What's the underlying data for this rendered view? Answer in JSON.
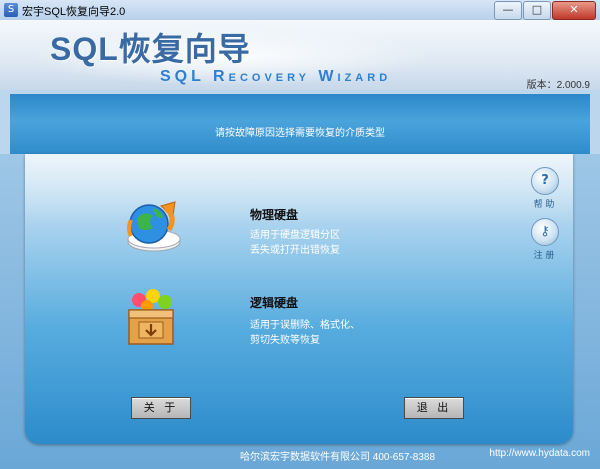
{
  "window": {
    "title": "宏宇SQL恢复向导2.0",
    "app_icon": "S",
    "controls": {
      "minimize": "—",
      "maximize": "□",
      "close": "✕"
    }
  },
  "header": {
    "main_title": "SQL恢复向导",
    "sub_title": "SQL Recovery Wizard",
    "version": "版本：2.000.9"
  },
  "instruction": "请按故障原因选择需要恢复的介质类型",
  "options": [
    {
      "title": "物理硬盘",
      "desc_line1": "适用于硬盘逻辑分区",
      "desc_line2": "丢失或打开出错恢复",
      "icon": "disk-refresh-icon"
    },
    {
      "title": "逻辑硬盘",
      "desc_line1": "适用于误删除、格式化、",
      "desc_line2": "剪切失败等恢复",
      "icon": "box-files-icon"
    }
  ],
  "side": {
    "help_label": "帮 助",
    "help_icon": "question-icon",
    "register_label": "注 册",
    "register_icon": "key-icon"
  },
  "buttons": {
    "about": "关 于",
    "exit": "退 出"
  },
  "footer": {
    "company": "哈尔滨宏宇数据软件有限公司  400-657-8388",
    "url": "http://www.hydata.com"
  }
}
